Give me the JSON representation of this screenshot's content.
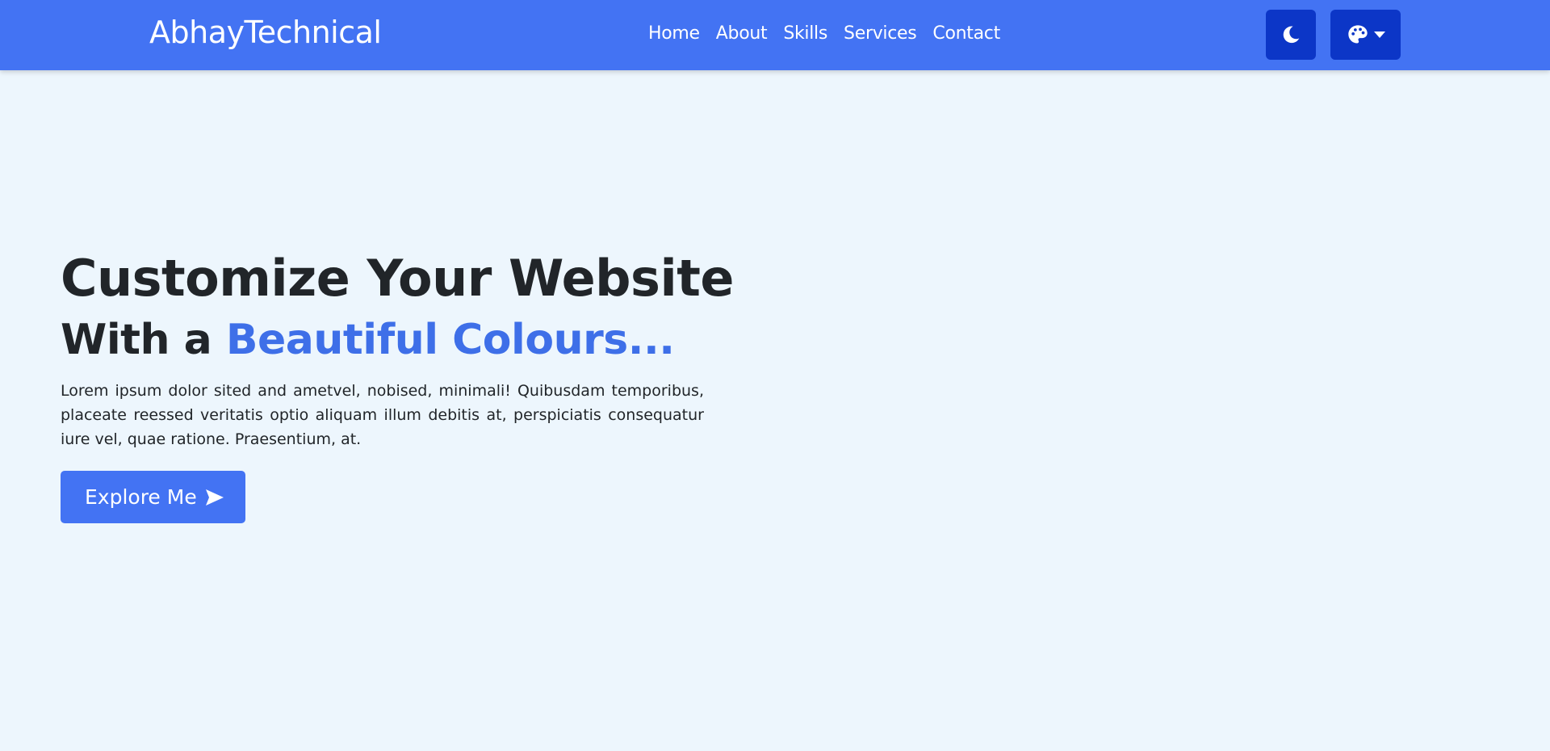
{
  "navbar": {
    "brand": "AbhayTechnical",
    "links": [
      "Home",
      "About",
      "Skills",
      "Services",
      "Contact"
    ],
    "theme_toggle_icon": "moon-icon",
    "palette_icon": "palette-icon",
    "palette_caret_icon": "caret-down-icon",
    "background_color": "#4373f3",
    "button_color": "#0c36c7"
  },
  "hero": {
    "title_line1": "Customize Your Website",
    "title_line2_prefix": "With a",
    "title_line2_accent": "Beautiful Colours...",
    "description": "Lorem ipsum dolor sited and ametvel, nobised, minimali! Quibusdam temporibus, placeate reessed veritatis optio aliquam illum debitis at, perspiciatis consequatur iure vel, quae ratione. Praesentium, at.",
    "cta_label": "Explore Me",
    "cta_icon": "paper-plane-icon",
    "accent_color": "#3e6fe8"
  },
  "page": {
    "background_color": "#edf6fd"
  }
}
